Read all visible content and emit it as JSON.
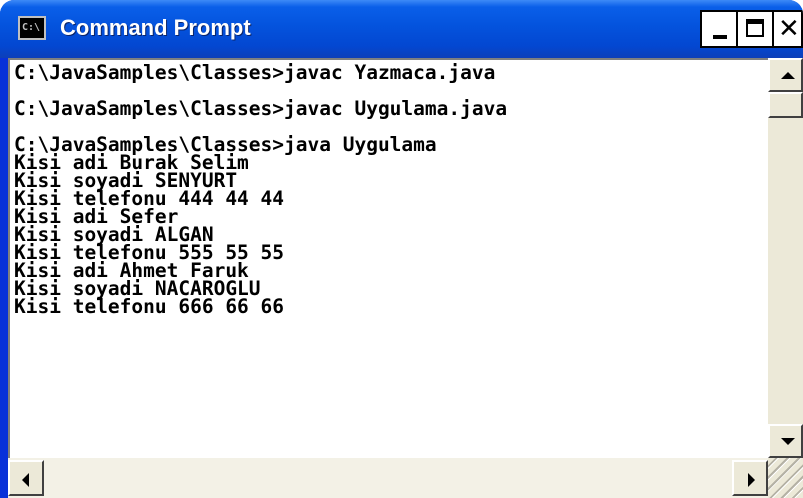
{
  "window": {
    "title": "Command Prompt",
    "icon": "console-icon",
    "icon_glyph": "C:\\",
    "titlebar_color": "#0453dd"
  },
  "console": {
    "lines": [
      "C:\\JavaSamples\\Classes>javac Yazmaca.java",
      "",
      "C:\\JavaSamples\\Classes>javac Uygulama.java",
      "",
      "C:\\JavaSamples\\Classes>java Uygulama",
      "Kisi adi Burak Selim",
      "Kisi soyadi SENYURT",
      "Kisi telefonu 444 44 44",
      "Kisi adi Sefer",
      "Kisi soyadi ALGAN",
      "Kisi telefonu 555 55 55",
      "Kisi adi Ahmet Faruk",
      "Kisi soyadi NACAROGLU",
      "Kisi telefonu 666 66 66"
    ]
  }
}
